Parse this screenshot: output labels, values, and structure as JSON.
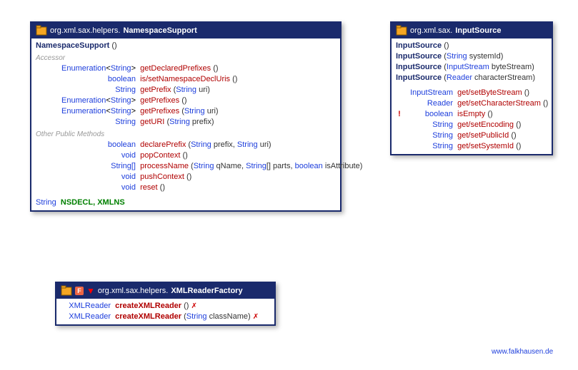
{
  "footer": {
    "url": "www.falkhausen.de"
  },
  "namespaceSupport": {
    "pkg": "org.xml.sax.helpers.",
    "name": "NamespaceSupport",
    "ctor": "NamespaceSupport",
    "accessorLabel": "Accessor",
    "otherLabel": "Other Public Methods",
    "accessors": [
      {
        "ret": "Enumeration<String>",
        "m": "getDeclaredPrefixes",
        "args": "()"
      },
      {
        "ret": "boolean",
        "m": "is/setNamespaceDeclUris",
        "args": "()"
      },
      {
        "ret": "String",
        "m": "getPrefix",
        "args": "(String uri)"
      },
      {
        "ret": "Enumeration<String>",
        "m": "getPrefixes",
        "args": "()"
      },
      {
        "ret": "Enumeration<String>",
        "m": "getPrefixes",
        "args": "(String uri)"
      },
      {
        "ret": "String",
        "m": "getURI",
        "args": "(String prefix)"
      }
    ],
    "others": [
      {
        "ret": "boolean",
        "m": "declarePrefix",
        "args_html": "(<span class='type'>String</span> prefix, <span class='type'>String</span> uri)"
      },
      {
        "ret": "void",
        "m": "popContext",
        "args_html": "()"
      },
      {
        "ret": "String[]",
        "m": "processName",
        "args_html": "(<span class='type'>String</span> qName, <span class='type'>String</span>[] parts, <span class='kw'>boolean</span> isAttribute)"
      },
      {
        "ret": "void",
        "m": "pushContext",
        "args_html": "()"
      },
      {
        "ret": "void",
        "m": "reset",
        "args_html": "()"
      }
    ],
    "fieldType": "String",
    "fields": "NSDECL, XMLNS"
  },
  "inputSource": {
    "pkg": "org.xml.sax.",
    "name": "InputSource",
    "ctors": [
      {
        "name": "InputSource",
        "args": "()"
      },
      {
        "name": "InputSource",
        "args_html": "(<span class='type'>String</span> systemId)"
      },
      {
        "name": "InputSource",
        "args_html": "(<span class='type'>InputStream</span> byteStream)"
      },
      {
        "name": "InputSource",
        "args_html": "(<span class='type'>Reader</span> characterStream)"
      }
    ],
    "methods": [
      {
        "mark": "",
        "ret": "InputStream",
        "m": "get/setByteStream",
        "args": "()"
      },
      {
        "mark": "",
        "ret": "Reader",
        "m": "get/setCharacterStream",
        "args": "()"
      },
      {
        "mark": "!",
        "ret": "boolean",
        "m": "isEmpty",
        "args": "()"
      },
      {
        "mark": "",
        "ret": "String",
        "m": "get/setEncoding",
        "args": "()"
      },
      {
        "mark": "",
        "ret": "String",
        "m": "get/setPublicId",
        "args": "()"
      },
      {
        "mark": "",
        "ret": "String",
        "m": "get/setSystemId",
        "args": "()"
      }
    ]
  },
  "xmlReaderFactory": {
    "pkg": "org.xml.sax.helpers.",
    "name": "XMLReaderFactory",
    "fBadge": "F",
    "methods": [
      {
        "ret": "XMLReader",
        "m": "createXMLReader",
        "args": "()",
        "dep": true
      },
      {
        "ret": "XMLReader",
        "m": "createXMLReader",
        "args_html": "(<span class='type'>String</span> className)",
        "dep": true
      }
    ]
  }
}
